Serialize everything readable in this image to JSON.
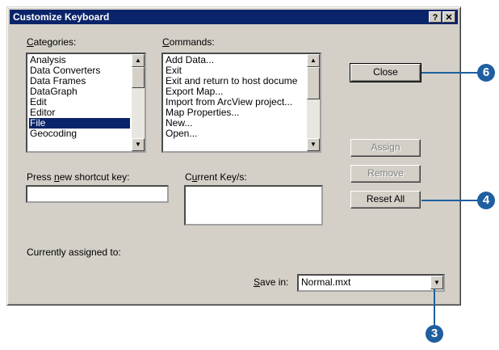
{
  "window": {
    "title": "Customize Keyboard",
    "help_button": "?",
    "close_button": "✕"
  },
  "categories": {
    "label_u": "C",
    "label_rest": "ategories:",
    "items": [
      "Analysis",
      "Data Converters",
      "Data Frames",
      "DataGraph",
      "Edit",
      "Editor",
      "File",
      "Geocoding"
    ],
    "selected": "File"
  },
  "commands": {
    "label_u": "C",
    "label_rest": "ommands:",
    "items": [
      "Add Data...",
      "Exit",
      "Exit and return to host docume",
      "Export Map...",
      "Import from ArcView project...",
      "Map Properties...",
      "New...",
      "Open..."
    ]
  },
  "shortcut": {
    "label_pre": "Press ",
    "label_u": "n",
    "label_rest": "ew shortcut key:",
    "value": ""
  },
  "current_keys": {
    "label_pre": "C",
    "label_u": "u",
    "label_rest": "rrent Key/s:"
  },
  "buttons": {
    "close": "Close",
    "assign": "Assign",
    "remove": "Remove",
    "reset_all": "Reset All"
  },
  "assigned": {
    "label": "Currently assigned to:"
  },
  "save_in": {
    "label_u": "S",
    "label_rest": "ave in:",
    "value": "Normal.mxt"
  },
  "callouts": {
    "close": "6",
    "reset_all": "4",
    "save_in": "3"
  },
  "colors": {
    "titlebar": "#0a246a",
    "face": "#d4d0c8",
    "selection": "#0a246a",
    "callout": "#1f5f9f"
  }
}
